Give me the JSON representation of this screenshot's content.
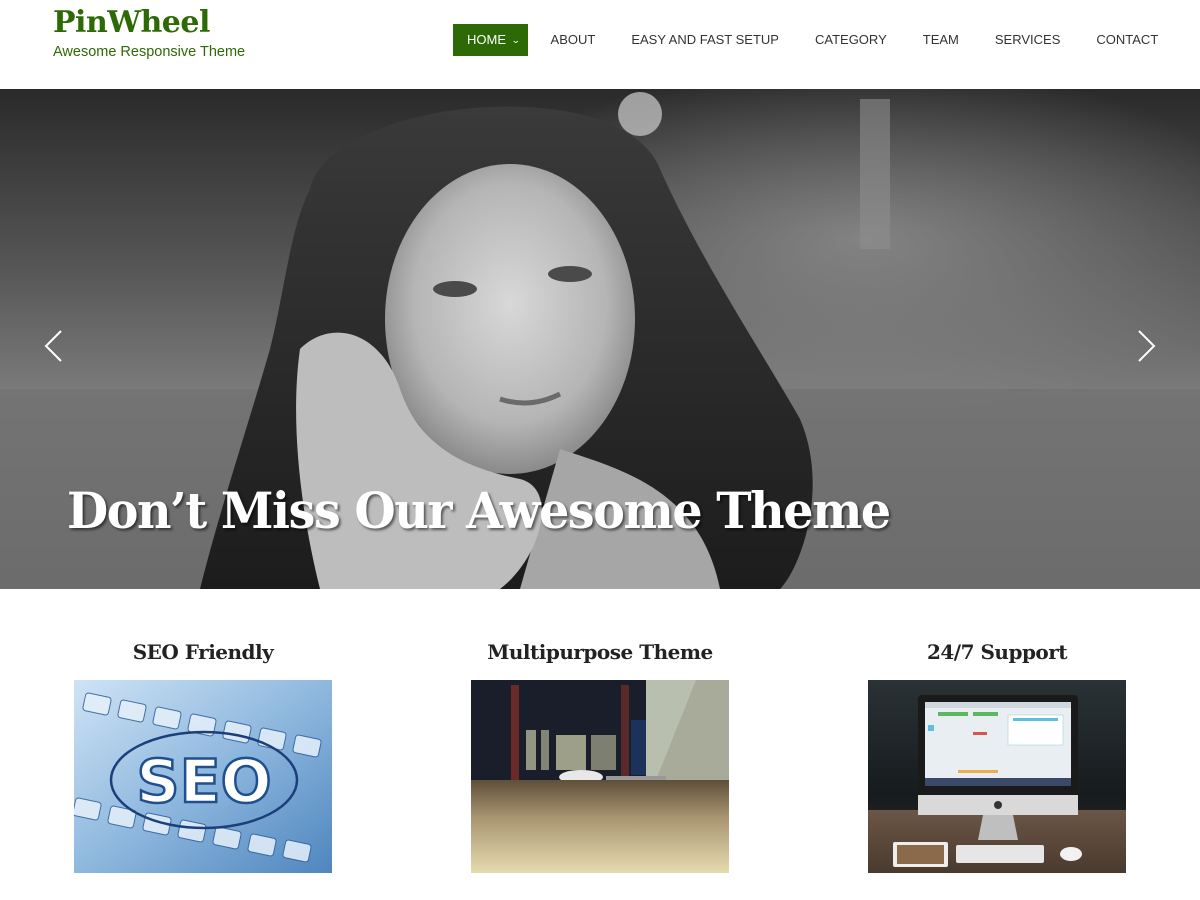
{
  "header": {
    "site_title": "PinWheel",
    "tagline": "Awesome Responsive Theme",
    "brand_color": "#2d6a05"
  },
  "nav": {
    "items": [
      {
        "label": "HOME",
        "active": true,
        "has_dropdown": true
      },
      {
        "label": "ABOUT"
      },
      {
        "label": "EASY AND FAST SETUP"
      },
      {
        "label": "CATEGORY"
      },
      {
        "label": "TEAM"
      },
      {
        "label": "SERVICES"
      },
      {
        "label": "CONTACT"
      }
    ],
    "dropdown_icon": "chevron-down-icon"
  },
  "hero": {
    "title": "Don’t Miss Our Awesome Theme",
    "image_alt": "Black and white photo of a young woman lying in grass, chin resting on hands",
    "prev_icon": "chevron-left-icon",
    "next_icon": "chevron-right-icon"
  },
  "features": [
    {
      "title": "SEO Friendly",
      "image_alt": "Blue keyboard with SEO text in an ellipse"
    },
    {
      "title": "Multipurpose Theme",
      "image_alt": "Laptop and mouse on a wooden desk with bookshelf behind"
    },
    {
      "title": "24/7 Support",
      "image_alt": "Desktop computer with tablet, keyboard and mouse on wooden desk"
    }
  ]
}
